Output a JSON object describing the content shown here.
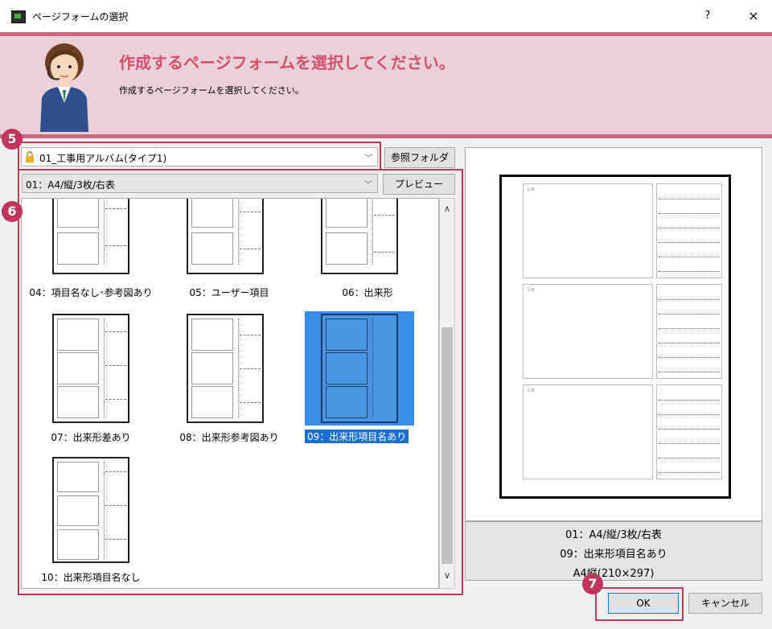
{
  "window": {
    "title": "ページフォームの選択",
    "help": "?",
    "close": "×"
  },
  "header": {
    "heading": "作成するページフォームを選択してください。",
    "subheading": "作成するページフォームを選択してください。"
  },
  "folder_select": {
    "value": "01_工事用アルバム(タイプ1)",
    "browse_button": "参照フォルダ"
  },
  "form_select": {
    "value": "01：A4/縦/3枚/右表",
    "preview_button": "プレビュー"
  },
  "form_list": [
    {
      "label": "04：項目名なし･参考図あり",
      "selected": false
    },
    {
      "label": "05：ユーザー項目",
      "selected": false
    },
    {
      "label": "06：出来形",
      "selected": false
    },
    {
      "label": "07：出来形差あり",
      "selected": false
    },
    {
      "label": "08：出来形参考図あり",
      "selected": false
    },
    {
      "label": "09：出来形項目名あり",
      "selected": true
    },
    {
      "label": "10：出来形項目名なし",
      "selected": false
    }
  ],
  "preview": {
    "photo_label": "写真",
    "info_line1": "01：A4/縦/3枚/右表",
    "info_line2": "09：出来形項目名あり",
    "info_line3": "A4縦(210×297)"
  },
  "buttons": {
    "ok": "OK",
    "cancel": "キャンセル"
  },
  "callouts": {
    "five": "5",
    "six": "6",
    "seven": "7"
  },
  "colors": {
    "accent": "#c9677f",
    "heading": "#d1516a",
    "callout": "#c0355a",
    "selection": "#1a6fd4"
  }
}
